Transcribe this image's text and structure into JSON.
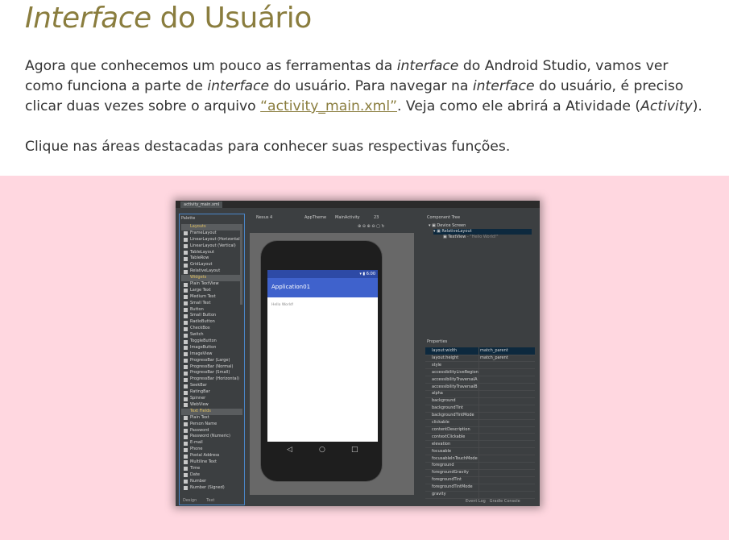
{
  "heading": {
    "emphasis": "Interface",
    "rest": " do Usuário"
  },
  "intro": {
    "t1": "Agora que conhecemos um pouco as ferramentas da ",
    "e1": "interface",
    "t2": " do Android Studio, vamos ver como funciona a parte de ",
    "e2": "interface",
    "t3": " do usuário. Para navegar na ",
    "e3": "interface",
    "t4": " do usuário, é preciso clicar duas vezes sobre o arquivo ",
    "link": "“activity_main.xml”",
    "t5": ". Veja como ele abrirá a Atividade (",
    "e4": "Activity",
    "t6": ")."
  },
  "instruction": "Clique nas áreas destacadas para conhecer suas respectivas funções.",
  "colors": {
    "accent": "#8a7d3e",
    "pink_band": "#ffd7e0",
    "ide_bg": "#3c3f41",
    "app_bar": "#3f62cc"
  },
  "ide": {
    "file_tab": "activity_main.xml",
    "palette_title": "Palette",
    "palette_items": [
      {
        "cat": true,
        "label": "Layouts"
      },
      {
        "label": "FrameLayout"
      },
      {
        "label": "LinearLayout (Horizontal)"
      },
      {
        "label": "LinearLayout (Vertical)"
      },
      {
        "label": "TableLayout"
      },
      {
        "label": "TableRow"
      },
      {
        "label": "GridLayout"
      },
      {
        "label": "RelativeLayout"
      },
      {
        "cat": true,
        "label": "Widgets"
      },
      {
        "label": "Plain TextView"
      },
      {
        "label": "Large Text"
      },
      {
        "label": "Medium Text"
      },
      {
        "label": "Small Text"
      },
      {
        "label": "Button"
      },
      {
        "label": "Small Button"
      },
      {
        "label": "RadioButton"
      },
      {
        "label": "CheckBox"
      },
      {
        "label": "Switch"
      },
      {
        "label": "ToggleButton"
      },
      {
        "label": "ImageButton"
      },
      {
        "label": "ImageView"
      },
      {
        "label": "ProgressBar (Large)"
      },
      {
        "label": "ProgressBar (Normal)"
      },
      {
        "label": "ProgressBar (Small)"
      },
      {
        "label": "ProgressBar (Horizontal)"
      },
      {
        "label": "SeekBar"
      },
      {
        "label": "RatingBar"
      },
      {
        "label": "Spinner"
      },
      {
        "label": "WebView"
      },
      {
        "cat": true,
        "label": "Text Fields"
      },
      {
        "label": "Plain Text"
      },
      {
        "label": "Person Name"
      },
      {
        "label": "Password"
      },
      {
        "label": "Password (Numeric)"
      },
      {
        "label": "E-mail"
      },
      {
        "label": "Phone"
      },
      {
        "label": "Postal Address"
      },
      {
        "label": "Multiline Text"
      },
      {
        "label": "Time"
      },
      {
        "label": "Date"
      },
      {
        "label": "Number"
      },
      {
        "label": "Number (Signed)"
      }
    ],
    "palette_tabs": {
      "design": "Design",
      "text": "Text"
    },
    "toolbar": {
      "device": "Nexus 4",
      "theme": "AppTheme",
      "activity": "MainActivity",
      "api": "23"
    },
    "phone": {
      "time": "6:00",
      "app_title": "Application01",
      "hello": "Hello World!"
    },
    "component_tree": {
      "title": "Component Tree",
      "rows": [
        {
          "label": "Device Screen"
        },
        {
          "label": "RelativeLayout"
        },
        {
          "label": "TextView",
          "extra": " - \"Hello World!\""
        }
      ]
    },
    "properties": {
      "title": "Properties",
      "rows": [
        {
          "key": "layout:width",
          "value": "match_parent"
        },
        {
          "key": "layout:height",
          "value": "match_parent"
        },
        {
          "key": "style",
          "value": ""
        },
        {
          "key": "accessibilityLiveRegion",
          "value": ""
        },
        {
          "key": "accessibilityTraversalA",
          "value": ""
        },
        {
          "key": "accessibilityTraversalB",
          "value": ""
        },
        {
          "key": "alpha",
          "value": ""
        },
        {
          "key": "background",
          "value": ""
        },
        {
          "key": "backgroundTint",
          "value": ""
        },
        {
          "key": "backgroundTintMode",
          "value": ""
        },
        {
          "key": "clickable",
          "value": ""
        },
        {
          "key": "contentDescription",
          "value": ""
        },
        {
          "key": "contextClickable",
          "value": ""
        },
        {
          "key": "elevation",
          "value": ""
        },
        {
          "key": "focusable",
          "value": ""
        },
        {
          "key": "focusableInTouchMode",
          "value": ""
        },
        {
          "key": "foreground",
          "value": ""
        },
        {
          "key": "foregroundGravity",
          "value": ""
        },
        {
          "key": "foregroundTint",
          "value": ""
        },
        {
          "key": "foregroundTintMode",
          "value": ""
        },
        {
          "key": "gravity",
          "value": ""
        }
      ]
    },
    "status_bar": {
      "event_log": "Event Log",
      "gradle_console": "Gradle Console"
    }
  }
}
